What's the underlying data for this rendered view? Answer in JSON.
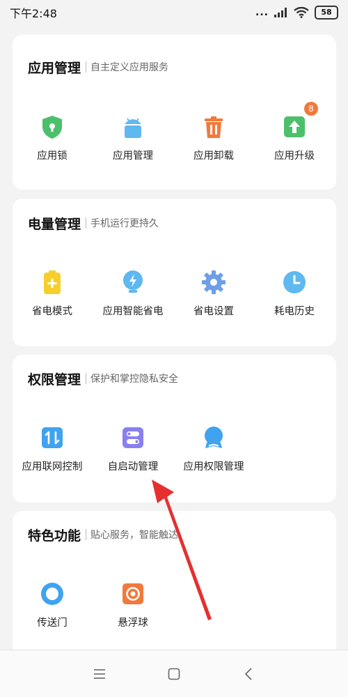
{
  "status_bar": {
    "time": "下午2:48",
    "signal_dots": "...",
    "battery": "58"
  },
  "sections": [
    {
      "title": "应用管理",
      "subtitle": "自主定义应用服务",
      "items": [
        {
          "label": "应用锁",
          "icon": "shield-icon"
        },
        {
          "label": "应用管理",
          "icon": "android-icon"
        },
        {
          "label": "应用卸载",
          "icon": "trash-icon"
        },
        {
          "label": "应用升级",
          "icon": "upgrade-icon",
          "badge": "8"
        }
      ]
    },
    {
      "title": "电量管理",
      "subtitle": "手机运行更持久",
      "items": [
        {
          "label": "省电模式",
          "icon": "battery-icon"
        },
        {
          "label": "应用智能省电",
          "icon": "bulb-icon"
        },
        {
          "label": "省电设置",
          "icon": "gear-icon"
        },
        {
          "label": "耗电历史",
          "icon": "clock-icon"
        }
      ]
    },
    {
      "title": "权限管理",
      "subtitle": "保护和掌控隐私安全",
      "items": [
        {
          "label": "应用联网控制",
          "icon": "network-icon"
        },
        {
          "label": "自启动管理",
          "icon": "toggle-icon"
        },
        {
          "label": "应用权限管理",
          "icon": "badge-icon"
        }
      ]
    },
    {
      "title": "特色功能",
      "subtitle": "贴心服务，智能触达",
      "items": [
        {
          "label": "传送门",
          "icon": "portal-icon"
        },
        {
          "label": "悬浮球",
          "icon": "float-ball-icon"
        }
      ]
    }
  ],
  "colors": {
    "green": "#4cbf6a",
    "blue_light": "#5fb8f0",
    "orange": "#f07a3c",
    "yellow": "#f6cf2c",
    "purple": "#8a7ff0",
    "blue": "#3fa3f0",
    "annotation_red": "#e53030"
  }
}
